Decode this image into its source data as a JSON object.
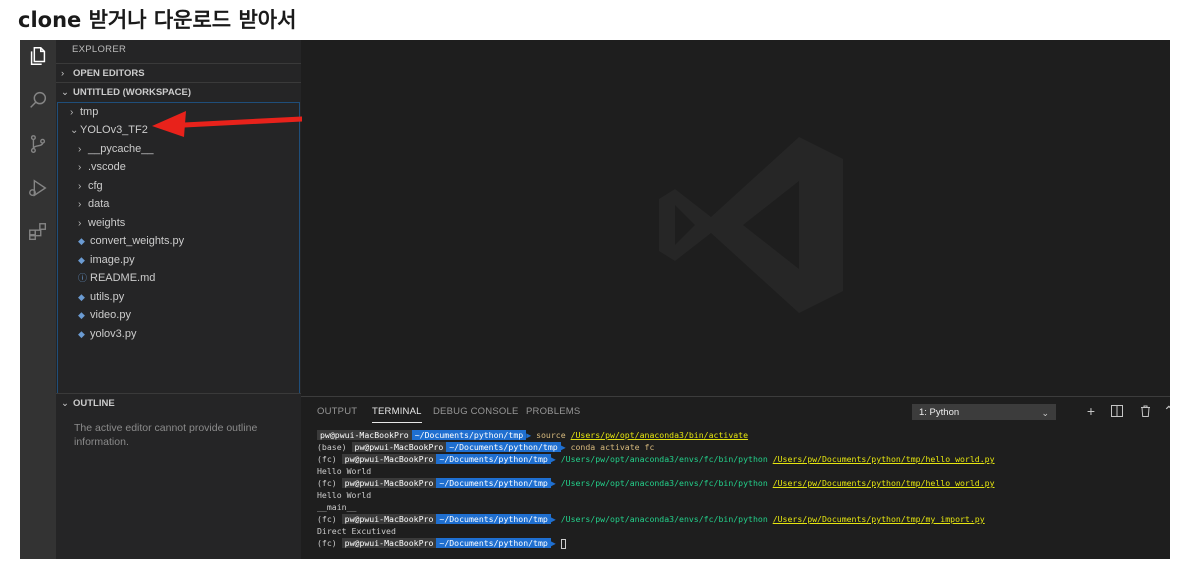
{
  "caption": "clone 받거나 다운로드 받아서",
  "activity_bar": {
    "icons": [
      "explorer-icon",
      "search-icon",
      "source-control-icon",
      "run-debug-icon",
      "extensions-icon"
    ]
  },
  "sidebar": {
    "title": "EXPLORER",
    "open_editors": "OPEN EDITORS",
    "workspace": "UNTITLED (WORKSPACE)",
    "tree": [
      {
        "label": "tmp",
        "type": "folder",
        "expanded": false,
        "depth": 0
      },
      {
        "label": "YOLOv3_TF2",
        "type": "folder",
        "expanded": true,
        "depth": 0
      },
      {
        "label": "__pycache__",
        "type": "folder",
        "expanded": false,
        "depth": 1
      },
      {
        "label": ".vscode",
        "type": "folder",
        "expanded": false,
        "depth": 1
      },
      {
        "label": "cfg",
        "type": "folder",
        "expanded": false,
        "depth": 1
      },
      {
        "label": "data",
        "type": "folder",
        "expanded": false,
        "depth": 1
      },
      {
        "label": "weights",
        "type": "folder",
        "expanded": false,
        "depth": 1
      },
      {
        "label": "convert_weights.py",
        "type": "python",
        "depth": 1
      },
      {
        "label": "image.py",
        "type": "python",
        "depth": 1
      },
      {
        "label": "README.md",
        "type": "info",
        "depth": 1
      },
      {
        "label": "utils.py",
        "type": "python",
        "depth": 1
      },
      {
        "label": "video.py",
        "type": "python",
        "depth": 1
      },
      {
        "label": "yolov3.py",
        "type": "python",
        "depth": 1
      }
    ],
    "outline": "OUTLINE",
    "outline_message": "The active editor cannot provide outline information."
  },
  "panel": {
    "tabs": [
      "OUTPUT",
      "TERMINAL",
      "DEBUG CONSOLE",
      "PROBLEMS"
    ],
    "active_tab": "TERMINAL",
    "terminal_select": "1: Python",
    "actions": [
      "add-icon",
      "split-icon",
      "trash-icon",
      "chevron-up-icon"
    ]
  },
  "terminal": {
    "host": "pw@pwui-MacBookPro",
    "dir": "~/Documents/python/tmp",
    "line1_cmd": "source",
    "line1_path": "/Users/pw/opt/anaconda3/bin/activate",
    "line2_prefix": "(base)",
    "line2_cmd": "conda activate fc",
    "env_prefix": "(fc)",
    "python_bin": "/Users/pw/opt/anaconda3/envs/fc/bin/python",
    "hello_path": "/Users/pw/Documents/python/tmp/hello_world.py",
    "hello_output": "Hello World",
    "main_output": "__main__",
    "import_path": "/Users/pw/Documents/python/tmp/my_import.py",
    "direct_output": "Direct Excutived"
  }
}
